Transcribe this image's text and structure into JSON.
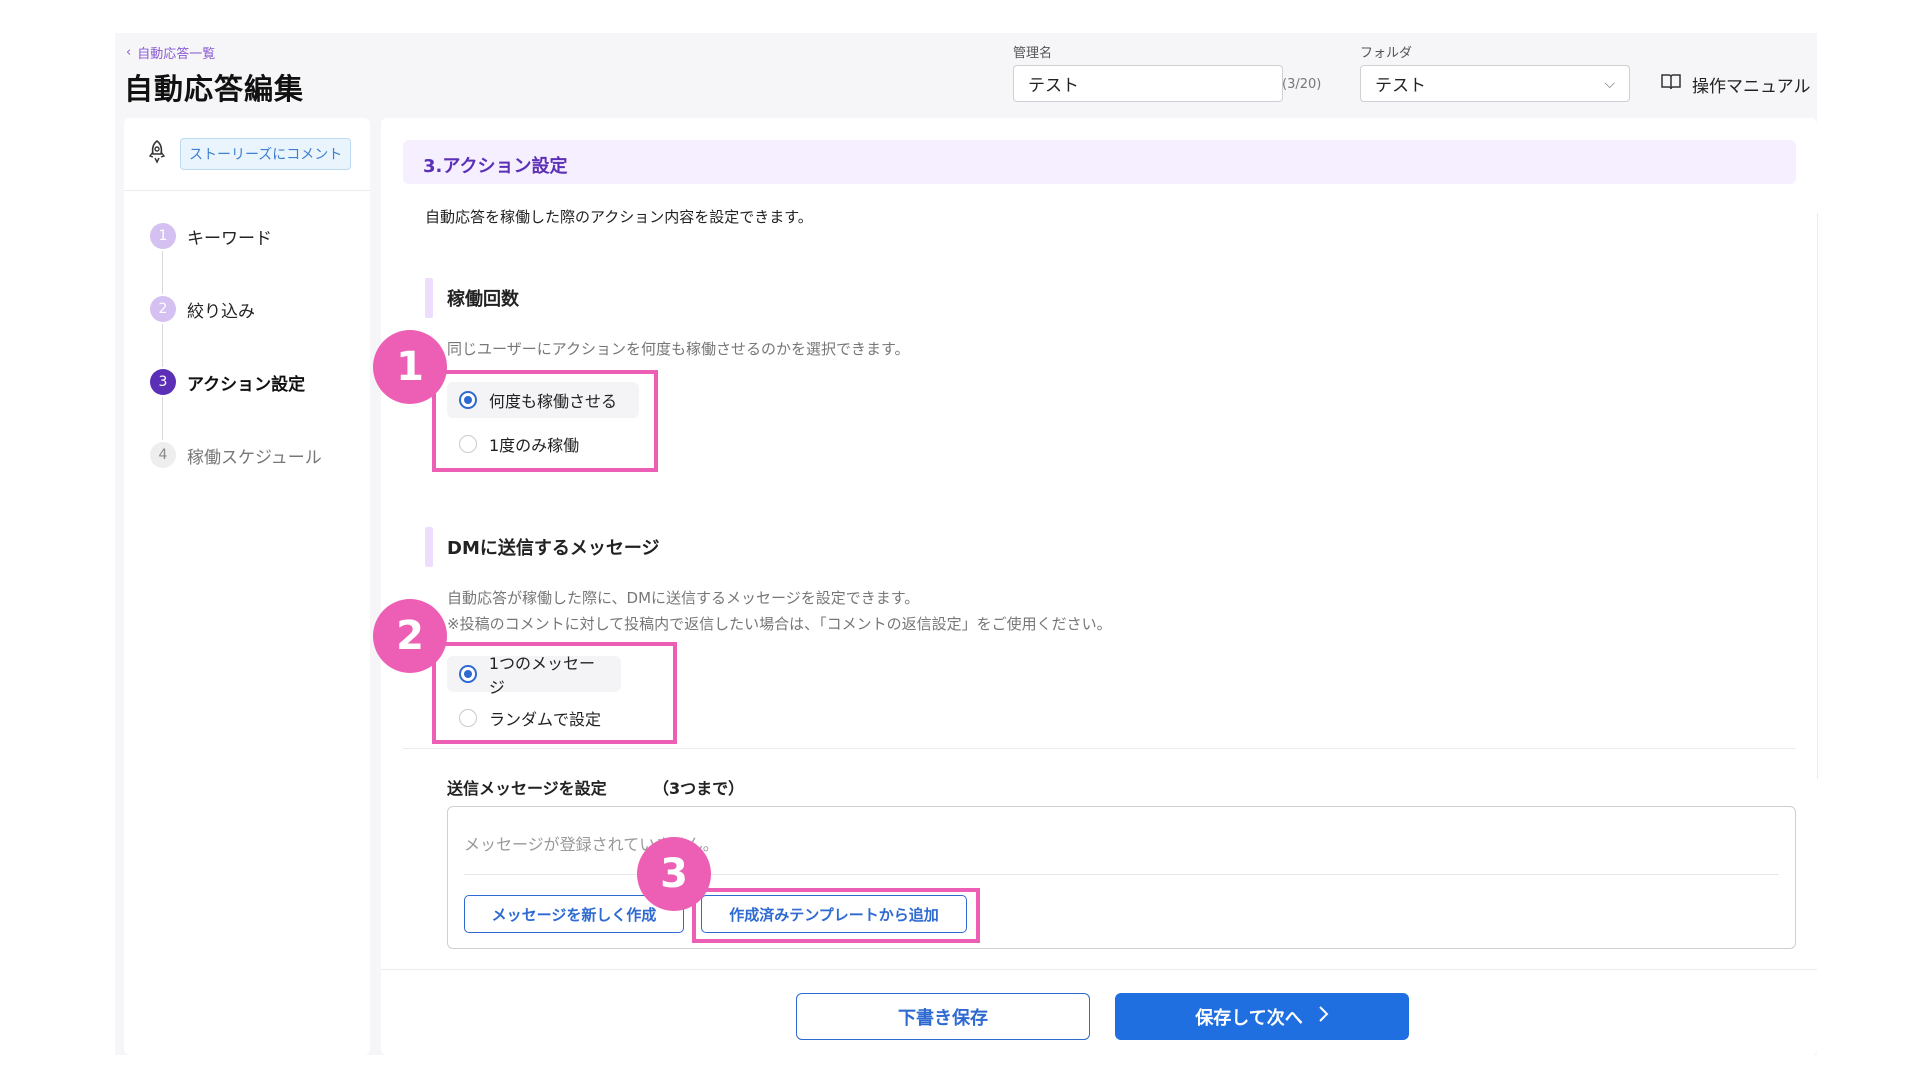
{
  "header": {
    "back_link": "自動応答一覧",
    "title": "自動応答編集",
    "name_label": "管理名",
    "name_value": "テスト",
    "name_counter": "(3/20)",
    "folder_label": "フォルダ",
    "folder_value": "テスト",
    "manual_label": "操作マニュアル"
  },
  "sidebar": {
    "trigger_badge": "ストーリーズにコメント",
    "steps": [
      {
        "num": "1",
        "label": "キーワード",
        "state": "done"
      },
      {
        "num": "2",
        "label": "絞り込み",
        "state": "done"
      },
      {
        "num": "3",
        "label": "アクション設定",
        "state": "active"
      },
      {
        "num": "4",
        "label": "稼働スケジュール",
        "state": "pending"
      }
    ]
  },
  "main": {
    "section_title": "3.アクション設定",
    "section_desc": "自動応答を稼働した際のアクション内容を設定できます。",
    "frequency": {
      "title": "稼働回数",
      "help": "同じユーザーにアクションを何度も稼働させるのかを選択できます。",
      "options": [
        "何度も稼働させる",
        "1度のみ稼働"
      ],
      "selected_index": 0
    },
    "dm": {
      "title": "DMに送信するメッセージ",
      "help1": "自動応答が稼働した際に、DMに送信するメッセージを設定できます。",
      "help2": "※投稿のコメントに対して投稿内で返信したい場合は、「コメントの返信設定」をご使用ください。",
      "options": [
        "1つのメッセージ",
        "ランダムで設定"
      ],
      "selected_index": 0
    },
    "messages": {
      "label": "送信メッセージを設定",
      "limit": "（3つまで）",
      "empty_text": "メッセージが登録されていません。",
      "new_button": "メッセージを新しく作成",
      "template_button": "作成済みテンプレートから追加"
    },
    "footer": {
      "draft_button": "下書き保存",
      "next_button": "保存して次へ"
    }
  },
  "annotations": [
    "1",
    "2",
    "3"
  ],
  "colors": {
    "accent_purple": "#5b2fb6",
    "primary_blue": "#1f6fe0",
    "annotation_pink": "#ec5fb4"
  }
}
